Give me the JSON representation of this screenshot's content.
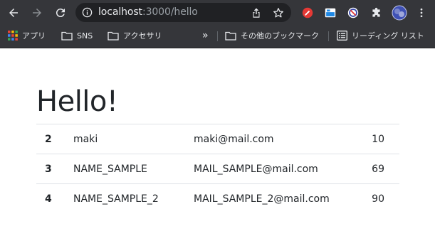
{
  "browser": {
    "url_host": "localhost",
    "url_path": ":3000/hello",
    "bookmarks": [
      {
        "label": "アプリ",
        "icon": "apps-grid-icon"
      },
      {
        "label": "SNS",
        "icon": "folder-icon"
      },
      {
        "label": "アクセサリ",
        "icon": "folder-icon"
      },
      {
        "label": "その他のブックマーク",
        "icon": "folder-icon"
      },
      {
        "label": "リーディング リスト",
        "icon": "reading-list-icon"
      }
    ],
    "overflow": "»"
  },
  "page": {
    "title": "Hello!",
    "rows": [
      {
        "id": "2",
        "name": "maki",
        "mail": "maki@mail.com",
        "age": "10"
      },
      {
        "id": "3",
        "name": "NAME_SAMPLE",
        "mail": "MAIL_SAMPLE@mail.com",
        "age": "69"
      },
      {
        "id": "4",
        "name": "NAME_SAMPLE_2",
        "mail": "MAIL_SAMPLE_2@mail.com",
        "age": "90"
      }
    ]
  }
}
